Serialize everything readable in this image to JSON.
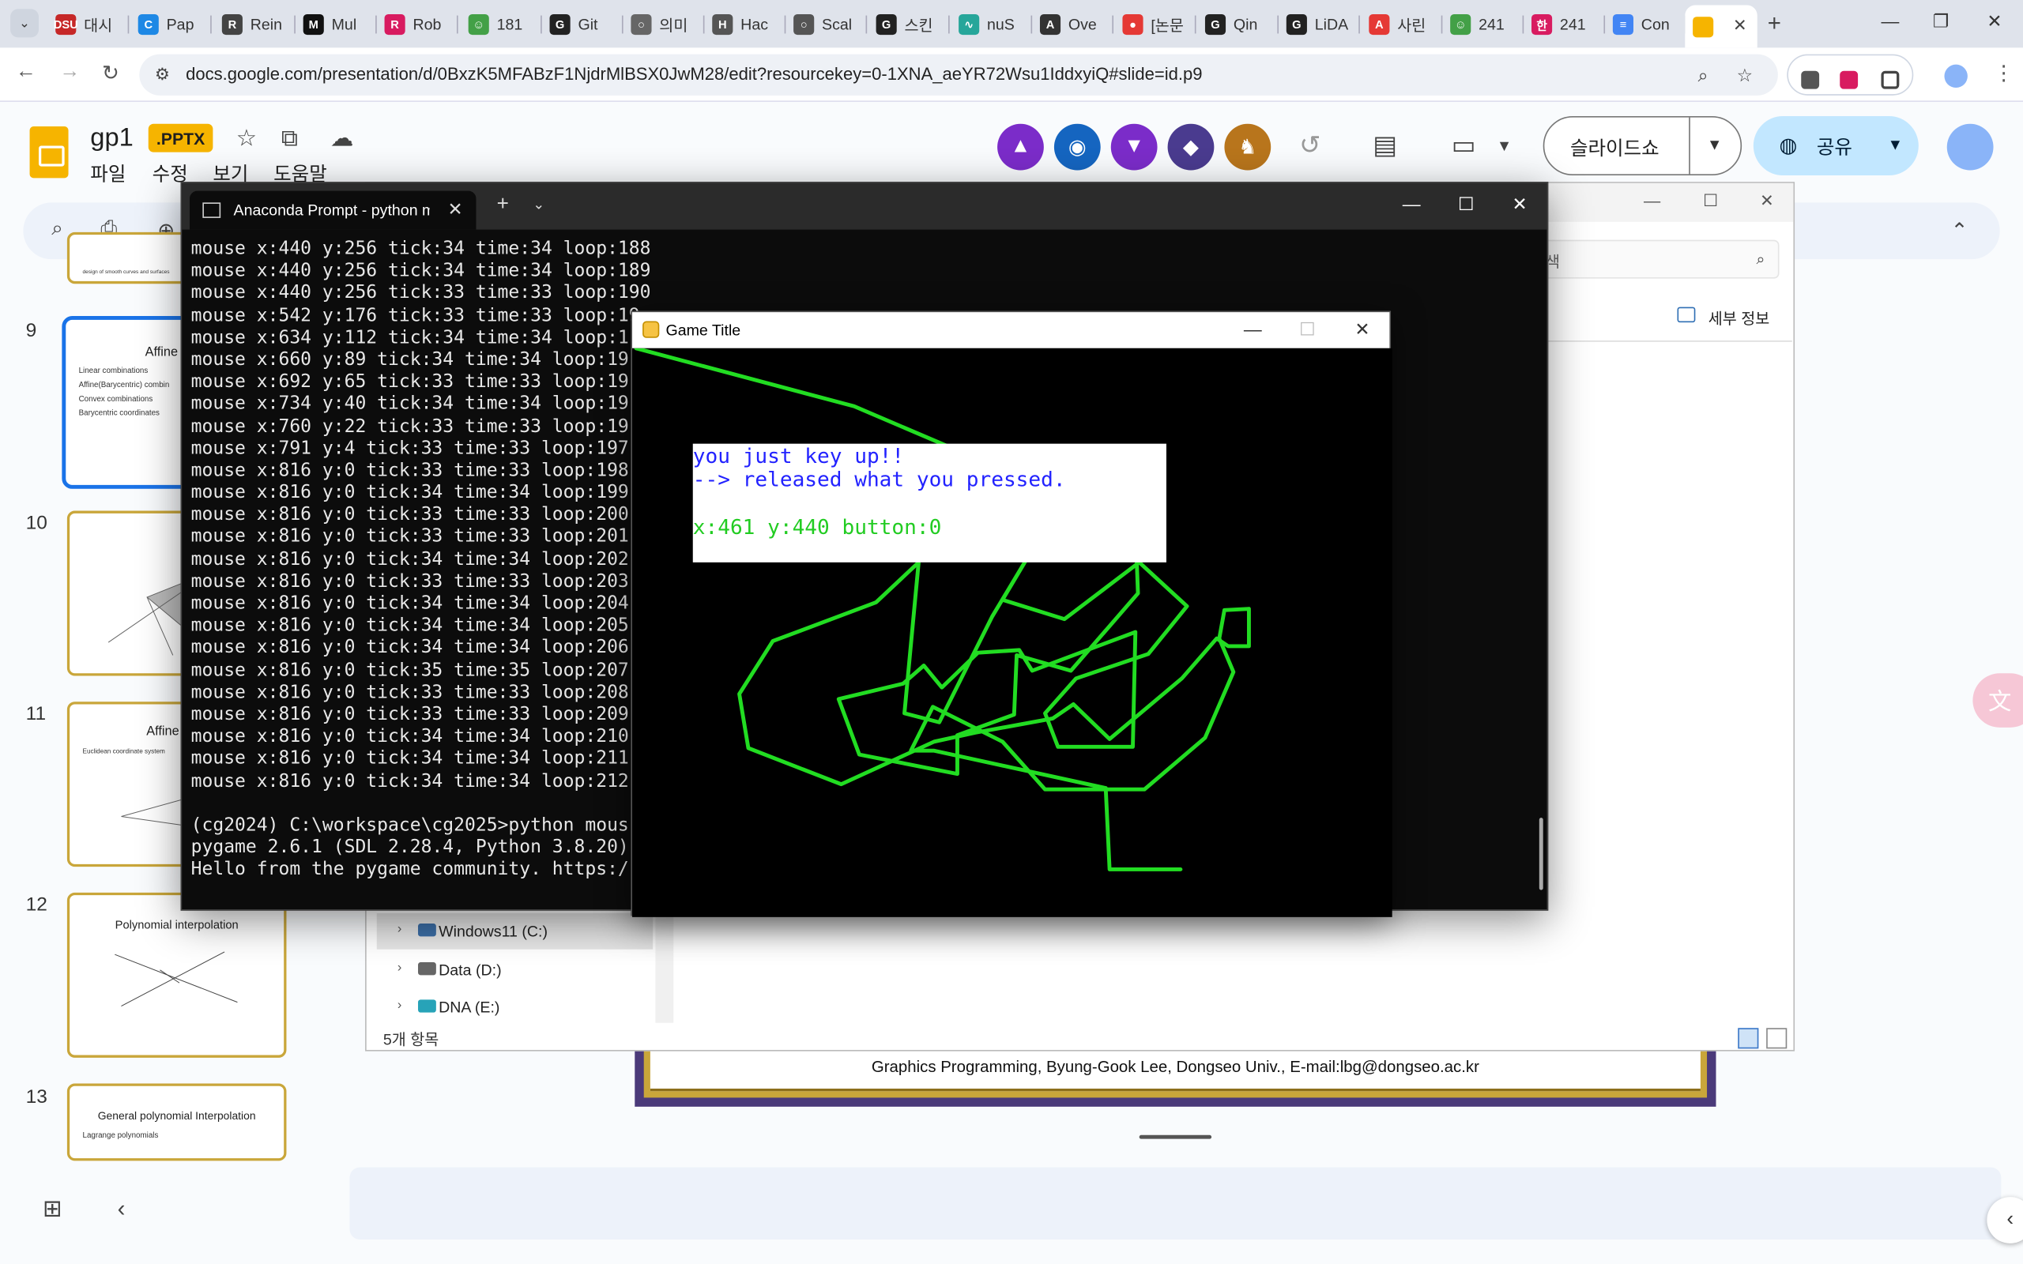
{
  "browser": {
    "tabs": [
      {
        "label": "대시",
        "favicon_color": "#c62828",
        "favicon_text": "DSU"
      },
      {
        "label": "Pap",
        "favicon_color": "#1e88e5",
        "favicon_text": "C"
      },
      {
        "label": "Rein",
        "favicon_color": "#444444",
        "favicon_text": "R"
      },
      {
        "label": "Mul",
        "favicon_color": "#111111",
        "favicon_text": "M"
      },
      {
        "label": "Rob",
        "favicon_color": "#d81b60",
        "favicon_text": "R"
      },
      {
        "label": "181",
        "favicon_color": "#43a047",
        "favicon_text": "☺"
      },
      {
        "label": "Git",
        "favicon_color": "#222222",
        "favicon_text": "G"
      },
      {
        "label": "의미",
        "favicon_color": "#666666",
        "favicon_text": "○"
      },
      {
        "label": "Hac",
        "favicon_color": "#555555",
        "favicon_text": "H"
      },
      {
        "label": "Scal",
        "favicon_color": "#555555",
        "favicon_text": "○"
      },
      {
        "label": "스킨",
        "favicon_color": "#222222",
        "favicon_text": "G"
      },
      {
        "label": "nuS",
        "favicon_color": "#26a69a",
        "favicon_text": "∿"
      },
      {
        "label": "Ove",
        "favicon_color": "#333333",
        "favicon_text": "A"
      },
      {
        "label": "[논문",
        "favicon_color": "#e53935",
        "favicon_text": "●"
      },
      {
        "label": "Qin",
        "favicon_color": "#222222",
        "favicon_text": "G"
      },
      {
        "label": "LiDA",
        "favicon_color": "#222222",
        "favicon_text": "G"
      },
      {
        "label": "사린",
        "favicon_color": "#e53935",
        "favicon_text": "A"
      },
      {
        "label": "241",
        "favicon_color": "#43a047",
        "favicon_text": "☺"
      },
      {
        "label": "241",
        "favicon_color": "#d81b60",
        "favicon_text": "한"
      },
      {
        "label": "Con",
        "favicon_color": "#4285f4",
        "favicon_text": "≡"
      }
    ],
    "url": "docs.google.com/presentation/d/0BxzK5MFABzF1NjdrMlBSX0JwM28/edit?resourcekey=0-1XNA_aeYR72Wsu1IddxyiQ#slide=id.p9"
  },
  "slides": {
    "doc_title": "gp1",
    "badge": ".PPTX",
    "menu": [
      "파일",
      "수정",
      "보기",
      "도움말"
    ],
    "slideshow_label": "슬라이드쇼",
    "share_label": "공유",
    "thumbnails": [
      {
        "num": "9",
        "title": "Affine com",
        "bullets": [
          "Linear combinations",
          "Affine(Barycentric) combin",
          "Convex combinations",
          "Barycentric coordinates"
        ],
        "selected": true
      },
      {
        "num": "10",
        "title": "",
        "bullets": [],
        "selected": false
      },
      {
        "num": "11",
        "title": "Affine com",
        "bullets": [
          "Euclidean coordinate system"
        ],
        "selected": false
      },
      {
        "num": "12",
        "title": "Polynomial interpolation",
        "bullets": [],
        "selected": false
      },
      {
        "num": "13",
        "title": "General polynomial Interpolation",
        "bullets": [
          "Lagrange polynomials"
        ],
        "selected": false
      }
    ],
    "slide_footer": "Graphics Programming, Byung-Gook Lee, Dongseo Univ., E-mail:lbg@dongseo.ac.kr"
  },
  "explorer": {
    "details_label": "세부 정보",
    "drives": [
      {
        "label": "Windows11 (C:)",
        "selected": true
      },
      {
        "label": "Data (D:)",
        "selected": false
      },
      {
        "label": "DNA (E:)",
        "selected": false
      }
    ],
    "status": "5개 항목"
  },
  "terminal": {
    "tab_title": "Anaconda Prompt - python m",
    "lines": [
      "mouse x:440 y:256 tick:34 time:34 loop:188",
      "mouse x:440 y:256 tick:34 time:34 loop:189",
      "mouse x:440 y:256 tick:33 time:33 loop:190",
      "mouse x:542 y:176 tick:33 time:33 loop:19",
      "mouse x:634 y:112 tick:34 time:34 loop:1",
      "mouse x:660 y:89 tick:34 time:34 loop:19",
      "mouse x:692 y:65 tick:33 time:33 loop:19",
      "mouse x:734 y:40 tick:34 time:34 loop:19",
      "mouse x:760 y:22 tick:33 time:33 loop:19",
      "mouse x:791 y:4 tick:33 time:33 loop:197",
      "mouse x:816 y:0 tick:33 time:33 loop:198",
      "mouse x:816 y:0 tick:34 time:34 loop:199",
      "mouse x:816 y:0 tick:33 time:33 loop:200",
      "mouse x:816 y:0 tick:33 time:33 loop:201",
      "mouse x:816 y:0 tick:34 time:34 loop:202",
      "mouse x:816 y:0 tick:33 time:33 loop:203",
      "mouse x:816 y:0 tick:34 time:34 loop:204",
      "mouse x:816 y:0 tick:34 time:34 loop:205",
      "mouse x:816 y:0 tick:34 time:34 loop:206",
      "mouse x:816 y:0 tick:35 time:35 loop:207",
      "mouse x:816 y:0 tick:33 time:33 loop:208",
      "mouse x:816 y:0 tick:33 time:33 loop:209",
      "mouse x:816 y:0 tick:34 time:34 loop:210",
      "mouse x:816 y:0 tick:34 time:34 loop:211",
      "mouse x:816 y:0 tick:34 time:34 loop:212",
      "",
      "(cg2024) C:\\workspace\\cg2025>python mous",
      "pygame 2.6.1 (SDL 2.28.4, Python 3.8.20)",
      "Hello from the pygame community. https:/"
    ]
  },
  "game": {
    "window_title": "Game Title",
    "line1": "you just key up!!",
    "line2": "--> released what you pressed.",
    "line3": "x:461 y:440 button:0",
    "text_color": "#2222ff",
    "coord_color": "#22cc22",
    "stroke_color": "#22dd22"
  }
}
